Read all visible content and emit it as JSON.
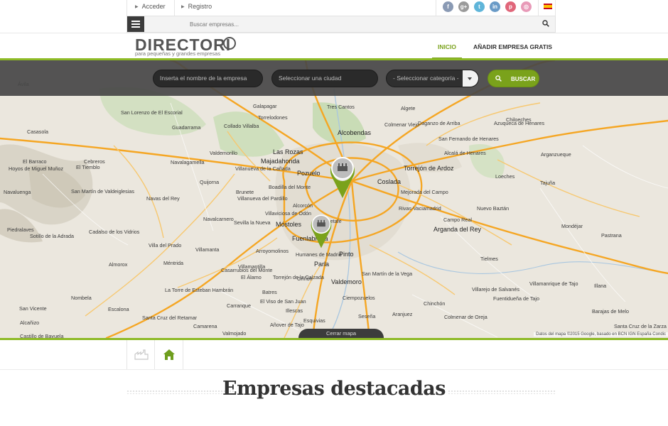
{
  "topbar": {
    "login_label": "Acceder",
    "register_label": "Registro",
    "social": [
      {
        "icon": "facebook-icon",
        "glyph": "f",
        "color": "#8a9ab4"
      },
      {
        "icon": "google-plus-icon",
        "glyph": "g+",
        "color": "#9a9a9a"
      },
      {
        "icon": "twitter-icon",
        "glyph": "t",
        "color": "#5fb5d9"
      },
      {
        "icon": "linkedin-icon",
        "glyph": "in",
        "color": "#6a9bc7"
      },
      {
        "icon": "pinterest-icon",
        "glyph": "p",
        "color": "#e0667a"
      },
      {
        "icon": "dribbble-icon",
        "glyph": "◎",
        "color": "#e89ab8"
      }
    ],
    "language_icon": "spain-flag-icon"
  },
  "search": {
    "placeholder": "Buscar empresas..."
  },
  "header": {
    "logo_text": "DIRECTORI",
    "logo_tagline": "para pequeñas y grandes empresas",
    "nav": {
      "home_label": "INICIO",
      "add_company_label": "AÑADIR EMPRESA GRATIS"
    }
  },
  "filters": {
    "company_placeholder": "Inserta el nombre de la empresa",
    "city_placeholder": "Seleccionar una ciudad",
    "category_selected": "- Seleccionar categoría -",
    "search_button_label": "BUSCAR"
  },
  "map": {
    "cities": [
      {
        "name": "Alcobendas",
        "big": true
      },
      {
        "name": "Las Rozas",
        "big": true
      },
      {
        "name": "Majadahonda",
        "big": true
      },
      {
        "name": "Pozuelo",
        "big": true
      },
      {
        "name": "Torrejón de Ardoz",
        "big": true
      },
      {
        "name": "Coslada",
        "big": true
      },
      {
        "name": "Móstoles",
        "big": true
      },
      {
        "name": "Fuenlabrada",
        "big": true
      },
      {
        "name": "Pinto",
        "big": true
      },
      {
        "name": "Parla",
        "big": true
      },
      {
        "name": "Valdemoro",
        "big": true
      },
      {
        "name": "Arganda del Rey",
        "big": true
      },
      {
        "name": "Alcalá de Henares",
        "big": false
      },
      {
        "name": "Tres Cantos",
        "big": false
      },
      {
        "name": "Colmenar Viejo",
        "big": false
      },
      {
        "name": "Galapagar",
        "big": false
      },
      {
        "name": "Torrelodones",
        "big": false
      },
      {
        "name": "Collado Villalba",
        "big": false
      },
      {
        "name": "San Lorenzo de El Escorial",
        "big": false
      },
      {
        "name": "Guadarrama",
        "big": false
      },
      {
        "name": "Cebreros",
        "big": false
      },
      {
        "name": "El Barraco",
        "big": false
      },
      {
        "name": "Navalagamella",
        "big": false
      },
      {
        "name": "Villanueva de la Cañada",
        "big": false
      },
      {
        "name": "Boadilla del Monte",
        "big": false
      },
      {
        "name": "Alcorcón",
        "big": false
      },
      {
        "name": "Villaviciosa de Odón",
        "big": false
      },
      {
        "name": "Navas del Rey",
        "big": false
      },
      {
        "name": "Villa del Prado",
        "big": false
      },
      {
        "name": "Arroyomolinos",
        "big": false
      },
      {
        "name": "Getafe",
        "big": false
      },
      {
        "name": "San Martín de la Vega",
        "big": false
      },
      {
        "name": "Aranjuez",
        "big": false
      },
      {
        "name": "Chinchón",
        "big": false
      },
      {
        "name": "Mejorada del Campo",
        "big": false
      },
      {
        "name": "Rivas-Vaciamadrid",
        "big": false
      },
      {
        "name": "San Fernando de Henares",
        "big": false
      },
      {
        "name": "Algete",
        "big": false
      },
      {
        "name": "Daganzo de Arriba",
        "big": false
      },
      {
        "name": "Loeches",
        "big": false
      },
      {
        "name": "Nuevo Baztán",
        "big": false
      },
      {
        "name": "Campo Real",
        "big": false
      },
      {
        "name": "Tielmes",
        "big": false
      },
      {
        "name": "Villarejo de Salvanés",
        "big": false
      },
      {
        "name": "Colmenar de Oreja",
        "big": false
      },
      {
        "name": "Illescas",
        "big": false
      },
      {
        "name": "Esquivias",
        "big": false
      },
      {
        "name": "Seseña",
        "big": false
      },
      {
        "name": "Ciempozuelos",
        "big": false
      },
      {
        "name": "Camarena",
        "big": false
      },
      {
        "name": "Nombela",
        "big": false
      },
      {
        "name": "Almorox",
        "big": false
      },
      {
        "name": "Escalona",
        "big": false
      },
      {
        "name": "Cadalso de los Vidrios",
        "big": false
      },
      {
        "name": "San Martín de Valdeiglesias",
        "big": false
      },
      {
        "name": "El Tiemblo",
        "big": false
      },
      {
        "name": "Navaluenga",
        "big": false
      },
      {
        "name": "Piedralaves",
        "big": false
      },
      {
        "name": "Sotillo de la Adrada",
        "big": false
      },
      {
        "name": "Brunete",
        "big": false
      },
      {
        "name": "Quijorna",
        "big": false
      },
      {
        "name": "Valdemorillo",
        "big": false
      },
      {
        "name": "Chiloeches",
        "big": false
      },
      {
        "name": "Azuqueca de Henares",
        "big": false
      },
      {
        "name": "Arganzueque",
        "big": false
      },
      {
        "name": "Tajuña",
        "big": false
      },
      {
        "name": "Mondéjar",
        "big": false
      },
      {
        "name": "Pastrana",
        "big": false
      },
      {
        "name": "Illana",
        "big": false
      },
      {
        "name": "Barajas de Melo",
        "big": false
      },
      {
        "name": "Santa Cruz de la Zarza",
        "big": false
      },
      {
        "name": "Villamanrique de Tajo",
        "big": false
      },
      {
        "name": "Fuentidueña de Tajo",
        "big": false
      },
      {
        "name": "Añover de Tajo",
        "big": false
      },
      {
        "name": "El Viso de San Juan",
        "big": false
      },
      {
        "name": "Carranque",
        "big": false
      },
      {
        "name": "Batres",
        "big": false
      },
      {
        "name": "La Torre de Esteban Hambrán",
        "big": false
      },
      {
        "name": "Méntrida",
        "big": false
      },
      {
        "name": "Casarrubios del Monte",
        "big": false
      },
      {
        "name": "Villamanta",
        "big": false
      },
      {
        "name": "Villamantilla",
        "big": false
      },
      {
        "name": "El Álamo",
        "big": false
      },
      {
        "name": "Navalcarnero",
        "big": false
      },
      {
        "name": "Sevilla la Nueva",
        "big": false
      },
      {
        "name": "Villanueva del Pardillo",
        "big": false
      },
      {
        "name": "Humanes de Madrid",
        "big": false
      },
      {
        "name": "Griñón",
        "big": false
      },
      {
        "name": "Torrejón de la Calzada",
        "big": false
      },
      {
        "name": "Yuncos",
        "big": false
      },
      {
        "name": "Valmojado",
        "big": false
      },
      {
        "name": "Santa Cruz del Retamar",
        "big": false
      },
      {
        "name": "Alcañizo",
        "big": false
      },
      {
        "name": "Castillo de Bayuela",
        "big": false
      },
      {
        "name": "San Vicente",
        "big": false
      },
      {
        "name": "Hoyos de Miguel Muñoz",
        "big": false
      },
      {
        "name": "Casasola",
        "big": false
      },
      {
        "name": "Ávila",
        "big": false
      }
    ],
    "attribution": "Datos del mapa ©2015 Google, basado en BCN IGN España   Condic",
    "close_label": "Cerrar mapa"
  },
  "tabs": [
    {
      "icon": "factory-icon"
    },
    {
      "icon": "home-icon"
    }
  ],
  "section": {
    "title": "Empresas destacadas"
  },
  "colors": {
    "accent": "#7aa21b",
    "line": "#8dba25",
    "dark_bar": "#464646"
  }
}
